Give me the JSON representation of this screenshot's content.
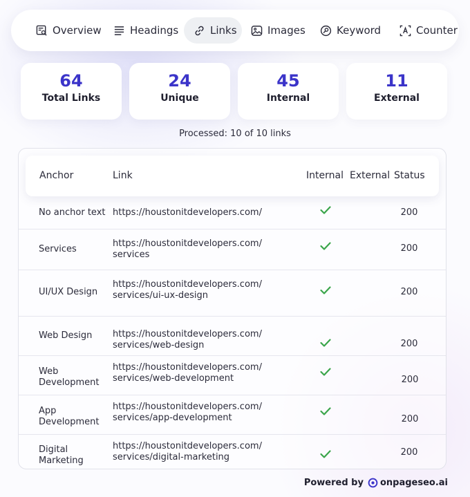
{
  "tabs": [
    {
      "label": "Overview",
      "icon": "overview-icon",
      "active": false
    },
    {
      "label": "Headings",
      "icon": "headings-icon",
      "active": false
    },
    {
      "label": "Links",
      "icon": "link-icon",
      "active": true
    },
    {
      "label": "Images",
      "icon": "image-icon",
      "active": false
    },
    {
      "label": "Keyword",
      "icon": "keyword-icon",
      "active": false
    },
    {
      "label": "Counter",
      "icon": "counter-icon",
      "active": false
    }
  ],
  "stats": [
    {
      "value": "64",
      "label": "Total Links"
    },
    {
      "value": "24",
      "label": "Unique"
    },
    {
      "value": "45",
      "label": "Internal"
    },
    {
      "value": "11",
      "label": "External"
    }
  ],
  "processed": "Processed: 10 of 10 links",
  "table": {
    "headers": {
      "anchor": "Anchor",
      "link": "Link",
      "internal": "Internal",
      "external": "External",
      "status": "Status"
    },
    "rows": [
      {
        "anchor": "No anchor text",
        "link": "https://houstonitdevelopers.com/",
        "internal": true,
        "external": false,
        "status": "200"
      },
      {
        "anchor": "Services",
        "link": "https://houstonitdevelopers.com/\nservices",
        "internal": true,
        "external": false,
        "status": "200"
      },
      {
        "anchor": "UI/UX Design",
        "link": "https://houstonitdevelopers.com/\nservices/ui-ux-design",
        "internal": true,
        "external": false,
        "status": "200"
      },
      {
        "anchor": "Web Design",
        "link": "https://houstonitdevelopers.com/\nservices/web-design",
        "internal": true,
        "external": false,
        "status": "200"
      },
      {
        "anchor": "Web\nDevelopment",
        "link": "https://houstonitdevelopers.com/\nservices/web-development",
        "internal": true,
        "external": false,
        "status": "200"
      },
      {
        "anchor": "App\nDevelopment",
        "link": "https://houstonitdevelopers.com/\nservices/app-development",
        "internal": true,
        "external": false,
        "status": "200"
      },
      {
        "anchor": "Digital\nMarketing",
        "link": "https://houstonitdevelopers.com/\nservices/digital-marketing",
        "internal": true,
        "external": false,
        "status": "200"
      }
    ]
  },
  "footer": {
    "powered_by": "Powered by",
    "brand": "onpageseo.ai"
  },
  "colors": {
    "accent": "#3b34c9",
    "check": "#3aa54a"
  }
}
